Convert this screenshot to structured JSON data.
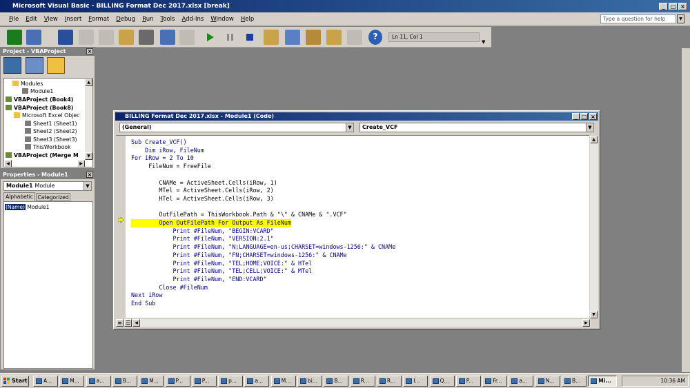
{
  "window": {
    "title": "Microsoft Visual Basic - BILLING Format Dec 2017.xlsx [break]",
    "help_placeholder": "Type a question for help"
  },
  "menu": [
    "File",
    "Edit",
    "View",
    "Insert",
    "Format",
    "Debug",
    "Run",
    "Tools",
    "Add-Ins",
    "Window",
    "Help"
  ],
  "toolbar": {
    "position": "Ln 11, Col 1"
  },
  "project": {
    "title": "Project - VBAProject",
    "tree": [
      {
        "label": "Modules",
        "bold": false
      },
      {
        "label": "Module1",
        "bold": false
      },
      {
        "label": "VBAProject (Book4)",
        "bold": true
      },
      {
        "label": "VBAProject (Book8)",
        "bold": true
      },
      {
        "label": "Microsoft Excel Objec",
        "bold": false
      },
      {
        "label": "Sheet1 (Sheet1)",
        "bold": false
      },
      {
        "label": "Sheet2 (Sheet2)",
        "bold": false
      },
      {
        "label": "Sheet3 (Sheet3)",
        "bold": false
      },
      {
        "label": "ThisWorkbook",
        "bold": false
      },
      {
        "label": "VBAProject (Merge M",
        "bold": true
      }
    ]
  },
  "properties": {
    "title": "Properties - Module1",
    "object_name": "Module1",
    "object_type": "Module",
    "tabs": [
      "Alphabetic",
      "Categorized"
    ],
    "rows": [
      {
        "name": "(Name)",
        "value": "Module1"
      }
    ]
  },
  "code_window": {
    "title": "BILLING Format Dec 2017.xlsx - Module1 (Code)",
    "object_combo": "(General)",
    "proc_combo": "Create_VCF",
    "lines": [
      "Sub Create_VCF()",
      "    Dim iRow, FileNum",
      "For iRow = 2 To 10",
      "     FileNum = FreeFile",
      "",
      "        CNAMe = ActiveSheet.Cells(iRow, 1)",
      "        MTel = ActiveSheet.Cells(iRow, 2)",
      "        HTel = ActiveSheet.Cells(iRow, 3)",
      "",
      "        OutFilePath = ThisWorkbook.Path & \"\\\" & CNAMe & \".VCF\"",
      "        Open OutFilePath For Output As FileNum",
      "            Print #FileNum, \"BEGIN:VCARD\"",
      "            Print #FileNum, \"VERSION:2.1\"",
      "            Print #FileNum, \"N;LANGUAGE=en-us;CHARSET=windows-1256:\" & CNAMe",
      "            Print #FileNum, \"FN;CHARSET=windows-1256:\" & CNAMe",
      "            Print #FileNum, \"TEL;HOME;VOICE:\" & HTel",
      "            Print #FileNum, \"TEL;CELL;VOICE:\" & MTel",
      "            Print #FileNum, \"END:VCARD\"",
      "        Close #FileNum",
      "Next iRow",
      "End Sub"
    ],
    "highlighted_line": 10
  },
  "taskbar": {
    "start": "Start",
    "tasks": [
      "A...",
      "M...",
      "a...",
      "B...",
      "M...",
      "P...",
      "P...",
      "p...",
      "a...",
      "M...",
      "bi...",
      "B...",
      "R...",
      "R...",
      "I...",
      "Q...",
      "P...",
      "Fr...",
      "a...",
      "N...",
      "B...",
      "Mi..."
    ],
    "clock": "10:36 AM"
  }
}
